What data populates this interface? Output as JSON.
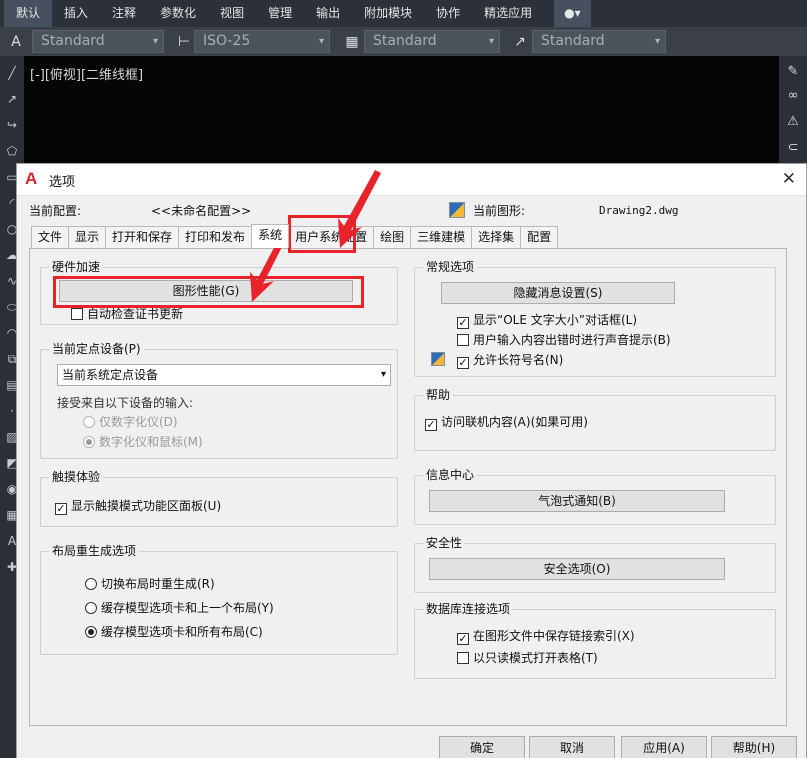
{
  "ribbon": {
    "tabs": [
      "默认",
      "插入",
      "注释",
      "参数化",
      "视图",
      "管理",
      "输出",
      "附加模块",
      "协作",
      "精选应用"
    ],
    "active_tab": "默认",
    "toggle_icon": "toggle-icon"
  },
  "toolbar": {
    "text_style": "Standard",
    "dim_style": "ISO-25",
    "table_style": "Standard",
    "mleader_style": "Standard"
  },
  "viewport": {
    "label": "[-][俯视][二维线框]"
  },
  "dialog": {
    "title": "选项",
    "current_profile_label": "当前配置:",
    "current_profile_value": "<<未命名配置>>",
    "current_drawing_label": "当前图形:",
    "current_drawing_value": "Drawing2.dwg",
    "tabs": [
      "文件",
      "显示",
      "打开和保存",
      "打印和发布",
      "系统",
      "用户系统配置",
      "绘图",
      "三维建模",
      "选择集",
      "配置"
    ],
    "active_tab": "系统",
    "hardware": {
      "title": "硬件加速",
      "graphics_button": "图形性能(G)",
      "auto_check_cert": "自动检查证书更新",
      "auto_check_cert_checked": false
    },
    "pointing": {
      "title": "当前定点设备(P)",
      "device_value": "当前系统定点设备",
      "accept_label": "接受来自以下设备的输入:",
      "digitizer_only": "仅数字化仪(D)",
      "digitizer_and_mouse": "数字化仪和鼠标(M)"
    },
    "touch": {
      "title": "触摸体验",
      "show_touch_panel": "显示触摸模式功能区面板(U)",
      "show_touch_panel_checked": true
    },
    "layout_regen": {
      "title": "布局重生成选项",
      "option1": "切换布局时重生成(R)",
      "option2": "缓存模型选项卡和上一个布局(Y)",
      "option3": "缓存模型选项卡和所有布局(C)",
      "selected": 3
    },
    "general": {
      "title": "常规选项",
      "hidden_messages_button": "隐藏消息设置(S)",
      "show_ole_dialog": "显示“OLE 文字大小”对话框(L)",
      "show_ole_dialog_checked": true,
      "beep_on_error": "用户输入内容出错时进行声音提示(B)",
      "beep_on_error_checked": false,
      "allow_long_names": "允许长符号名(N)",
      "allow_long_names_checked": true
    },
    "help": {
      "title": "帮助",
      "access_online": "访问联机内容(A)(如果可用)",
      "access_online_checked": true
    },
    "info_center": {
      "title": "信息中心",
      "balloon_button": "气泡式通知(B)"
    },
    "security": {
      "title": "安全性",
      "security_button": "安全选项(O)"
    },
    "db_connect": {
      "title": "数据库连接选项",
      "store_links": "在图形文件中保存链接索引(X)",
      "store_links_checked": true,
      "open_readonly": "以只读模式打开表格(T)",
      "open_readonly_checked": false
    },
    "footer": {
      "ok": "确定",
      "cancel": "取消",
      "apply": "应用(A)",
      "help": "帮助(H)"
    }
  },
  "colors": {
    "highlight": "#e8232a",
    "autocad_red": "#d4262c"
  }
}
